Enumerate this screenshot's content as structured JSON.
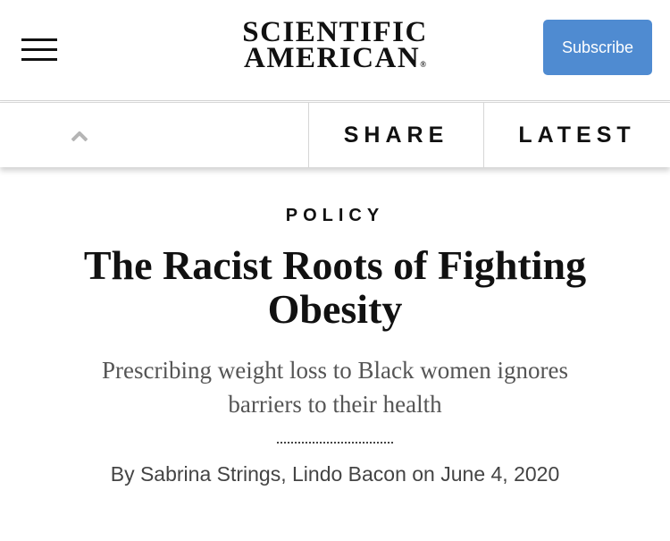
{
  "header": {
    "logo_line1": "SCIENTIFIC",
    "logo_line2": "AMERICAN",
    "logo_reg": "®",
    "subscribe_label": "Subscribe",
    "menu_icon": "hamburger-menu-icon"
  },
  "toolbar": {
    "up_icon": "chevron-up-icon",
    "share_label": "SHARE",
    "latest_label": "LATEST"
  },
  "article": {
    "section": "POLICY",
    "title": "The Racist Roots of Fighting Obesity",
    "subtitle": "Prescribing weight loss to Black women ignores barriers to their health",
    "byline": "By Sabrina Strings, Lindo Bacon on June 4, 2020"
  },
  "colors": {
    "subscribe_bg": "#4f8bd1",
    "text": "#111111",
    "subtitle": "#555555",
    "byline": "#444444"
  }
}
